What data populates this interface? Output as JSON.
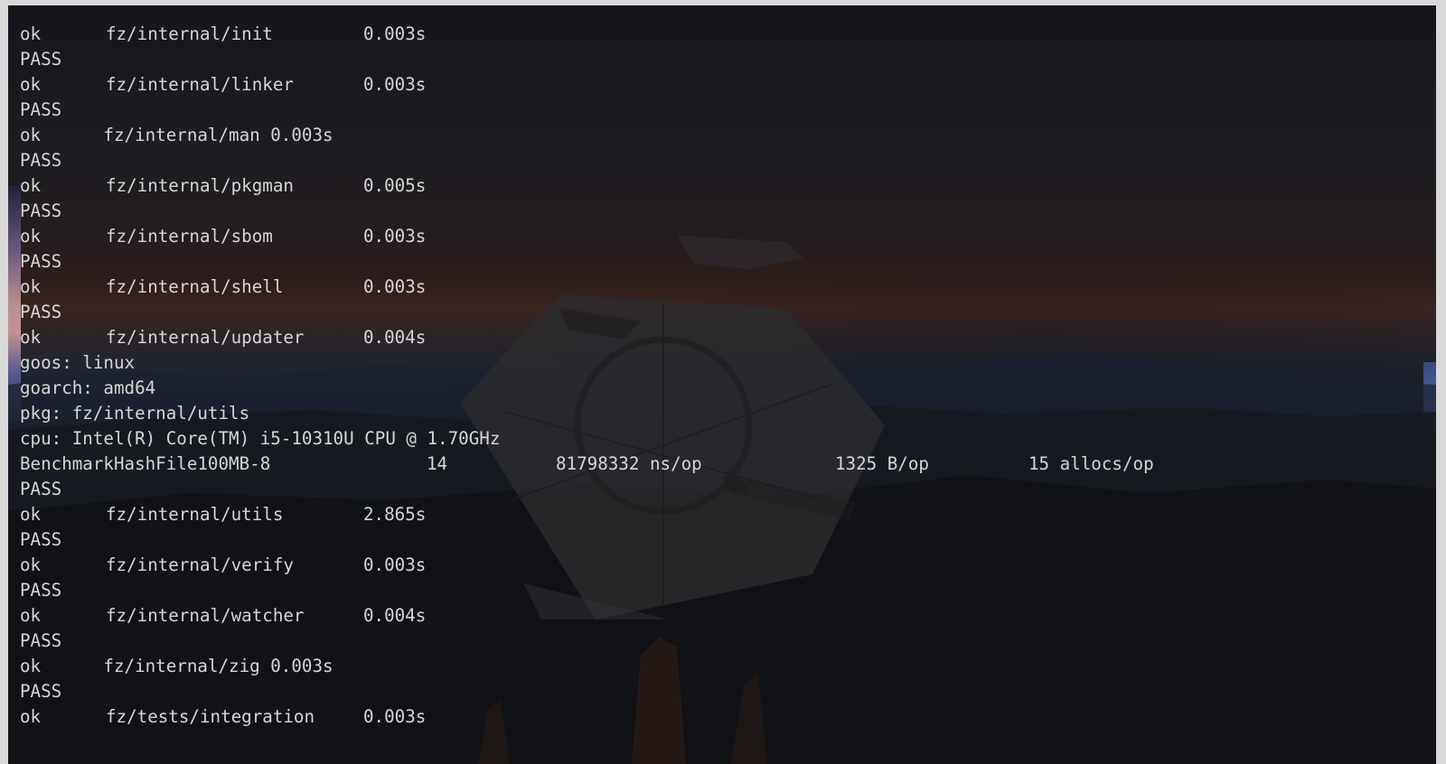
{
  "terminal": {
    "lines": [
      {
        "kind": "ok",
        "status": "ok",
        "package": "fz/internal/init",
        "time": "0.003s"
      },
      {
        "kind": "text",
        "text": "PASS"
      },
      {
        "kind": "ok",
        "status": "ok",
        "package": "fz/internal/linker",
        "time": "0.003s"
      },
      {
        "kind": "text",
        "text": "PASS"
      },
      {
        "kind": "text",
        "text": "ok      fz/internal/man 0.003s"
      },
      {
        "kind": "text",
        "text": "PASS"
      },
      {
        "kind": "ok",
        "status": "ok",
        "package": "fz/internal/pkgman",
        "time": "0.005s"
      },
      {
        "kind": "text",
        "text": "PASS"
      },
      {
        "kind": "ok",
        "status": "ok",
        "package": "fz/internal/sbom",
        "time": "0.003s"
      },
      {
        "kind": "text",
        "text": "PASS"
      },
      {
        "kind": "ok",
        "status": "ok",
        "package": "fz/internal/shell",
        "time": "0.003s"
      },
      {
        "kind": "text",
        "text": "PASS"
      },
      {
        "kind": "ok",
        "status": "ok",
        "package": "fz/internal/updater",
        "time": "0.004s"
      },
      {
        "kind": "text",
        "text": "goos: linux"
      },
      {
        "kind": "text",
        "text": "goarch: amd64"
      },
      {
        "kind": "text",
        "text": "pkg: fz/internal/utils"
      },
      {
        "kind": "text",
        "text": "cpu: Intel(R) Core(TM) i5-10310U CPU @ 1.70GHz"
      },
      {
        "kind": "bench",
        "name": "BenchmarkHashFile100MB-8",
        "iterations": "14",
        "ns_per_op": "81798332 ns/op",
        "bytes_per_op": "1325 B/op",
        "allocs_per_op": "15 allocs/op"
      },
      {
        "kind": "text",
        "text": "PASS"
      },
      {
        "kind": "ok",
        "status": "ok",
        "package": "fz/internal/utils",
        "time": "2.865s"
      },
      {
        "kind": "text",
        "text": "PASS"
      },
      {
        "kind": "ok",
        "status": "ok",
        "package": "fz/internal/verify",
        "time": "0.003s"
      },
      {
        "kind": "text",
        "text": "PASS"
      },
      {
        "kind": "ok",
        "status": "ok",
        "package": "fz/internal/watcher",
        "time": "0.004s"
      },
      {
        "kind": "text",
        "text": "PASS"
      },
      {
        "kind": "text",
        "text": "ok      fz/internal/zig 0.003s"
      },
      {
        "kind": "text",
        "text": "PASS"
      },
      {
        "kind": "ok",
        "status": "ok",
        "package": "fz/tests/integration",
        "time": "0.003s"
      }
    ]
  },
  "colors": {
    "text": "#d6d6d6",
    "background": "#15161b"
  },
  "icons": {
    "wallpaper_logo": "hexagon-refresh-logo-icon"
  }
}
